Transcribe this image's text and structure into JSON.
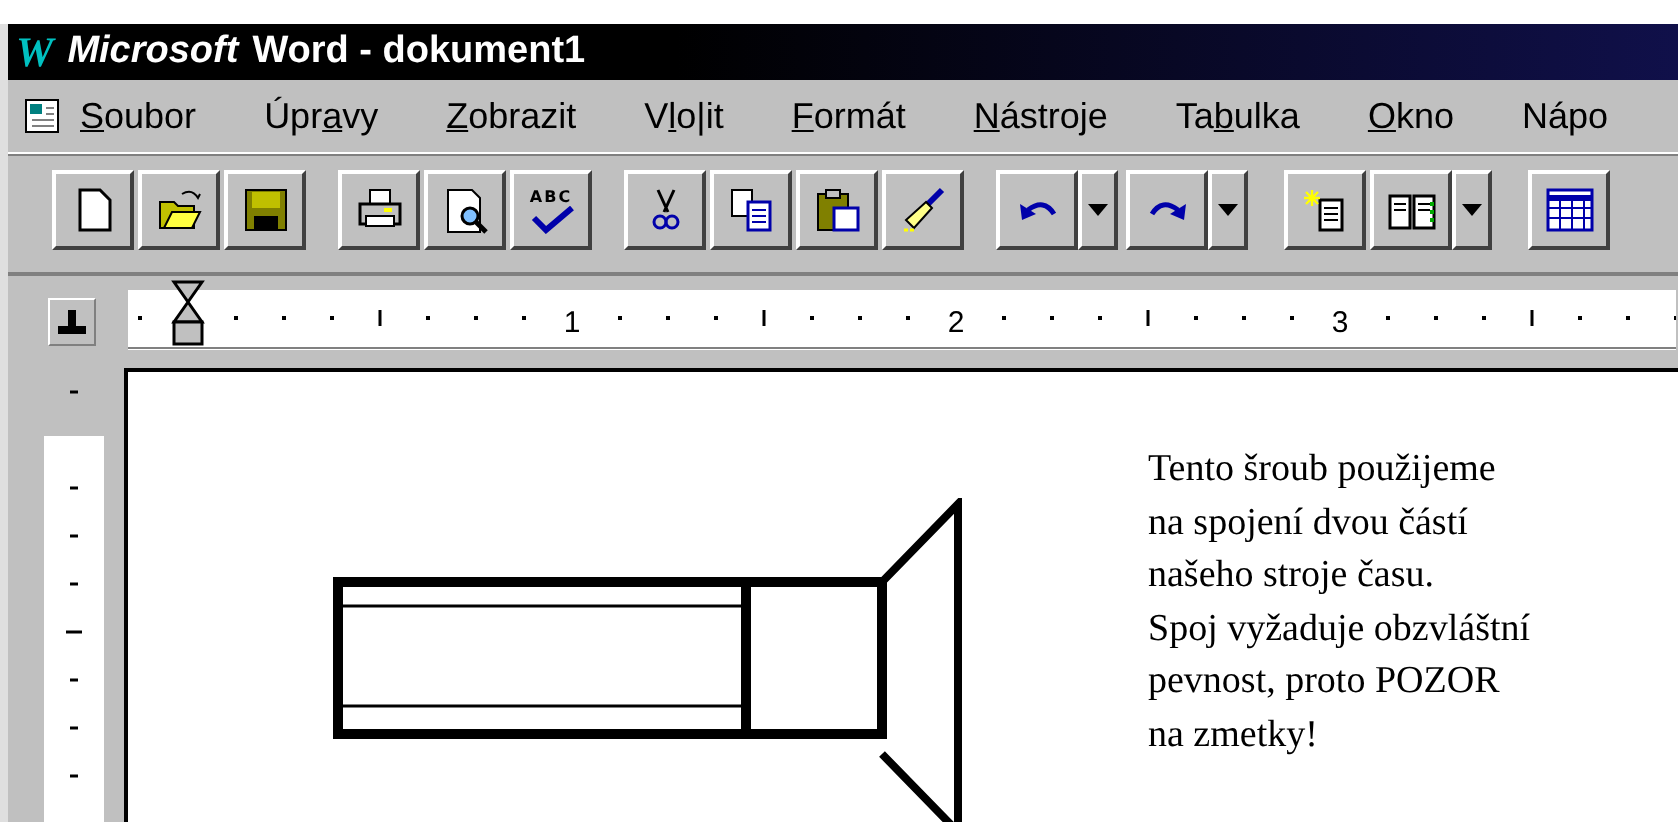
{
  "window": {
    "title_logo": "W",
    "title_brand": "Microsoft",
    "title": "Word - dokument1"
  },
  "menu": [
    {
      "key": "S",
      "after": "oubor"
    },
    {
      "before": "Úpr",
      "key": "a",
      "after": "vy"
    },
    {
      "key": "Z",
      "after": "obrazit"
    },
    {
      "before": "V",
      "key": "l",
      "after": "o|it"
    },
    {
      "key": "F",
      "after": "ormát"
    },
    {
      "key": "N",
      "after": "ástroje"
    },
    {
      "before": "Ta",
      "key": "b",
      "after": "ulka"
    },
    {
      "key": "O",
      "after": "kno"
    },
    {
      "before": "Nápo"
    }
  ],
  "toolbar": [
    [
      {
        "kind": "new"
      },
      {
        "kind": "open"
      },
      {
        "kind": "save"
      }
    ],
    [
      {
        "kind": "print"
      },
      {
        "kind": "preview"
      },
      {
        "kind": "spell",
        "text": "ABC"
      }
    ],
    [
      {
        "kind": "cut"
      },
      {
        "kind": "copy"
      },
      {
        "kind": "paste"
      },
      {
        "kind": "brush"
      }
    ],
    [
      {
        "kind": "undo",
        "dropdown": true
      },
      {
        "kind": "redo",
        "dropdown": true
      }
    ],
    [
      {
        "kind": "autotext"
      },
      {
        "kind": "book",
        "dropdown": true
      }
    ],
    [
      {
        "kind": "table"
      }
    ]
  ],
  "ruler": {
    "labels": [
      "1",
      "2",
      "3"
    ]
  },
  "document": {
    "lines": [
      "Tento šroub použijeme",
      "na spojení dvou částí",
      "našeho stroje času.",
      "Spoj vyžaduje obzvláštní",
      "pevnost, proto POZOR",
      "na zmetky!"
    ]
  }
}
